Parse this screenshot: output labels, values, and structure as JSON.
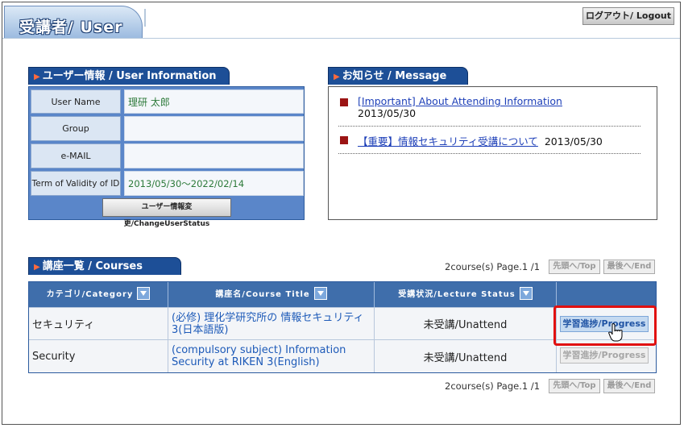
{
  "header": {
    "title": "受講者/ User",
    "logout_label": "ログアウト/ Logout"
  },
  "user_info": {
    "tab_label": "ユーザー情報 / User Information",
    "rows": [
      {
        "label": "User Name",
        "value": "理研 太郎"
      },
      {
        "label": "Group",
        "value": ""
      },
      {
        "label": "e-MAIL",
        "value": ""
      },
      {
        "label": "Term of Validity of ID",
        "value": "2013/05/30～2022/02/14"
      }
    ],
    "change_button": "ユーザー情報変更/ChangeUserStatus"
  },
  "messages": {
    "tab_label": "お知らせ / Message",
    "items": [
      {
        "link": "[Important] About Attending Information",
        "date": "2013/05/30"
      },
      {
        "link": "【重要】情報セキュリティ受講について",
        "date": "2013/05/30"
      }
    ]
  },
  "courses": {
    "tab_label": "講座一覧 / Courses",
    "pager_text": "2course(s) Page.1 /1",
    "first_label": "先頭へ/Top",
    "last_label": "最後へ/End",
    "headers": [
      "カテゴリ/Category",
      "講座名/Course Title",
      "受講状況/Lecture Status",
      ""
    ],
    "rows": [
      {
        "category": "セキュリティ",
        "title": "(必修) 理化学研究所の 情報セキュリティ 3(日本語版)",
        "status": "未受講/Unattend",
        "button": "学習進捗/Progress"
      },
      {
        "category": "Security",
        "title": "(compulsory subject) Information Security at RIKEN 3(English)",
        "status": "未受講/Unattend",
        "button": "学習進捗/Progress"
      }
    ]
  },
  "colors": {
    "accent": "#1d4f97",
    "highlight": "#e11010",
    "link": "#1d5ab8"
  }
}
